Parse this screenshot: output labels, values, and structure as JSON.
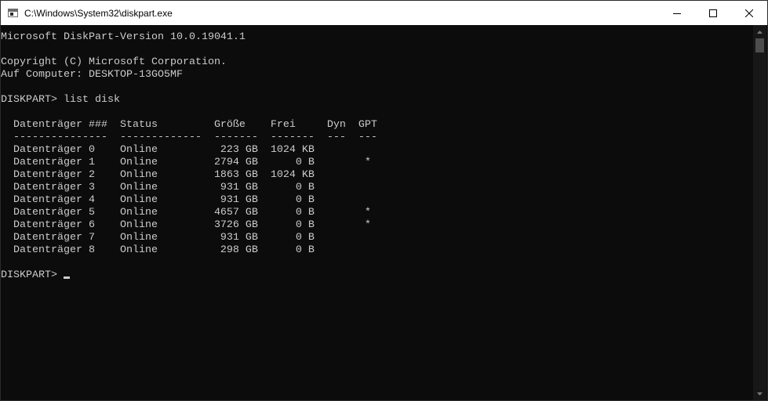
{
  "window": {
    "title": "C:\\Windows\\System32\\diskpart.exe",
    "controls": {
      "minimize_icon": "minimize-icon",
      "maximize_icon": "maximize-icon",
      "close_icon": "close-icon"
    }
  },
  "console": {
    "lines": [
      "Microsoft DiskPart-Version 10.0.19041.1",
      "",
      "Copyright (C) Microsoft Corporation.",
      "Auf Computer: DESKTOP-13GO5MF",
      "",
      "DISKPART> list disk",
      "",
      "  Datenträger ###  Status         Größe    Frei     Dyn  GPT",
      "  ---------------  -------------  -------  -------  ---  ---",
      "  Datenträger 0    Online          223 GB  1024 KB",
      "  Datenträger 1    Online         2794 GB      0 B        *",
      "  Datenträger 2    Online         1863 GB  1024 KB",
      "  Datenträger 3    Online          931 GB      0 B",
      "  Datenträger 4    Online          931 GB      0 B",
      "  Datenträger 5    Online         4657 GB      0 B        *",
      "  Datenträger 6    Online         3726 GB      0 B        *",
      "  Datenträger 7    Online          931 GB      0 B",
      "  Datenträger 8    Online          298 GB      0 B",
      ""
    ],
    "prompt": "DISKPART> ",
    "colors": {
      "background": "#0c0c0c",
      "text": "#cccccc"
    }
  }
}
